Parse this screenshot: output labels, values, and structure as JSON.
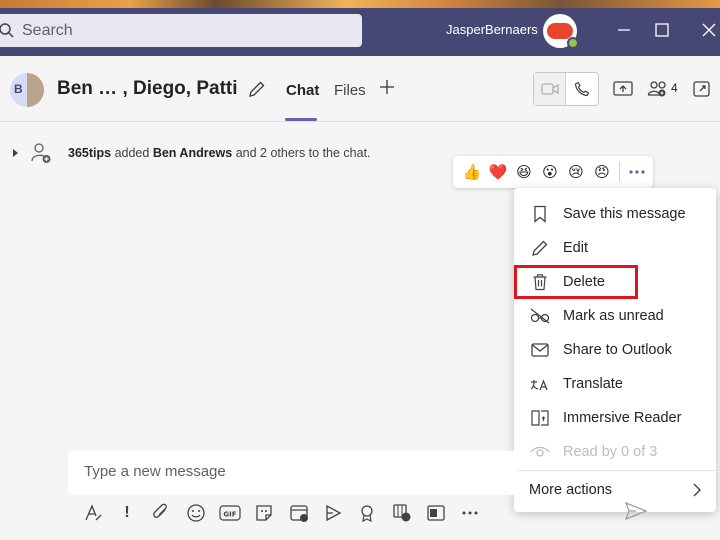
{
  "window": {
    "search_placeholder": "Search",
    "user_name": "JasperBernaers"
  },
  "header": {
    "avatar_initial": "B",
    "chat_title": "Ben …  , Diego, Patti",
    "tabs": [
      {
        "label": "Chat",
        "active": true
      },
      {
        "label": "Files",
        "active": false
      }
    ],
    "participants_count": "4"
  },
  "system_message": {
    "actor": "365tips",
    "verb": " added ",
    "target": "Ben Andrews",
    "rest": " and 2 others to the chat."
  },
  "reactions": [
    "👍",
    "❤️",
    "😆",
    "😮",
    "😢",
    "😠"
  ],
  "context_menu": {
    "items": [
      {
        "label": "Save this message",
        "icon": "bookmark-icon",
        "disabled": false
      },
      {
        "label": "Edit",
        "icon": "pencil-icon",
        "disabled": false
      },
      {
        "label": "Delete",
        "icon": "trash-icon",
        "disabled": false
      },
      {
        "label": "Mark as unread",
        "icon": "eye-off-icon",
        "disabled": false
      },
      {
        "label": "Share to Outlook",
        "icon": "mail-icon",
        "disabled": false
      },
      {
        "label": "Translate",
        "icon": "translate-icon",
        "disabled": false
      },
      {
        "label": "Immersive Reader",
        "icon": "immersive-reader-icon",
        "disabled": false
      },
      {
        "label": "Read by 0 of 3",
        "icon": "eye-icon",
        "disabled": true
      }
    ],
    "more_actions": "More actions",
    "highlighted": "Delete",
    "highlight_color": "#e0161e"
  },
  "compose": {
    "placeholder": "Type a new message"
  },
  "colors": {
    "titlebar": "#464775",
    "accent": "#6264a7",
    "like_heart": "#e02f3d"
  }
}
